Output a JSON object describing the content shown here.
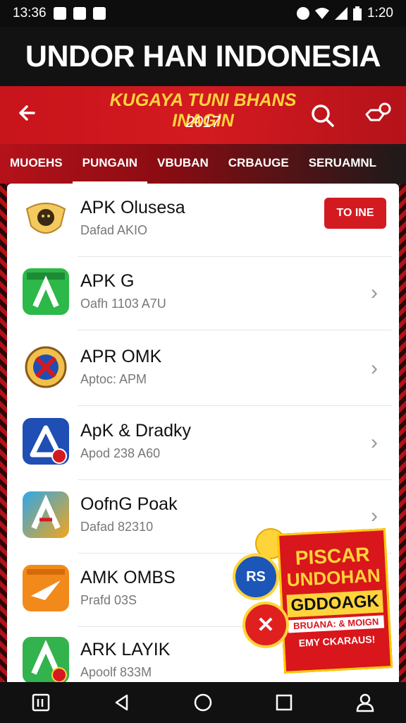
{
  "status_bar": {
    "time_left": "13:36",
    "time_right": "1:20"
  },
  "headline": "UNDOR HAN INDONESIA",
  "app_bar": {
    "title": "KUGAYA TUNI BHANS INAGIN",
    "subtitle": "2017",
    "icons": [
      "back-arrow-icon",
      "search-icon",
      "notification-icon"
    ]
  },
  "tabs": [
    {
      "label": "MUOEHS",
      "active": false
    },
    {
      "label": "PUNGAIN",
      "active": true
    },
    {
      "label": "VBUBAN",
      "active": false
    },
    {
      "label": "CRBAUGE",
      "active": false
    },
    {
      "label": "SERUAMNL",
      "active": false
    }
  ],
  "apps": [
    {
      "name": "APK Olusesa",
      "sub": "Dafad AKIO",
      "action": "TO INE",
      "icon_color": "#f4c95d"
    },
    {
      "name": "APK G",
      "sub": "Oafh 1103 A7U",
      "icon_color": "#2db84a"
    },
    {
      "name": "APR OMK",
      "sub": "Aptoc: APM",
      "icon_color": "#f2c04a"
    },
    {
      "name": "ApK & Dradky",
      "sub": "Apod 238 A60",
      "icon_color": "#1f4fb5"
    },
    {
      "name": "OofnG Poak",
      "sub": "Dafad 82310",
      "icon_color": "#2fa7e8"
    },
    {
      "name": "AMK OMBS",
      "sub": "Prafd 03S",
      "icon_color": "#f28a1b"
    },
    {
      "name": "ARK LAYIK",
      "sub": "Apoolf 833M",
      "icon_color": "#32b34d"
    }
  ],
  "promo": {
    "line1": "PISCAR",
    "line2": "UNDOHAN",
    "line3": "GDDOAGK",
    "line4": "BRUANA: & MOIGN",
    "line5": "EMY CKARAUS!",
    "badge_blue": "RS"
  }
}
